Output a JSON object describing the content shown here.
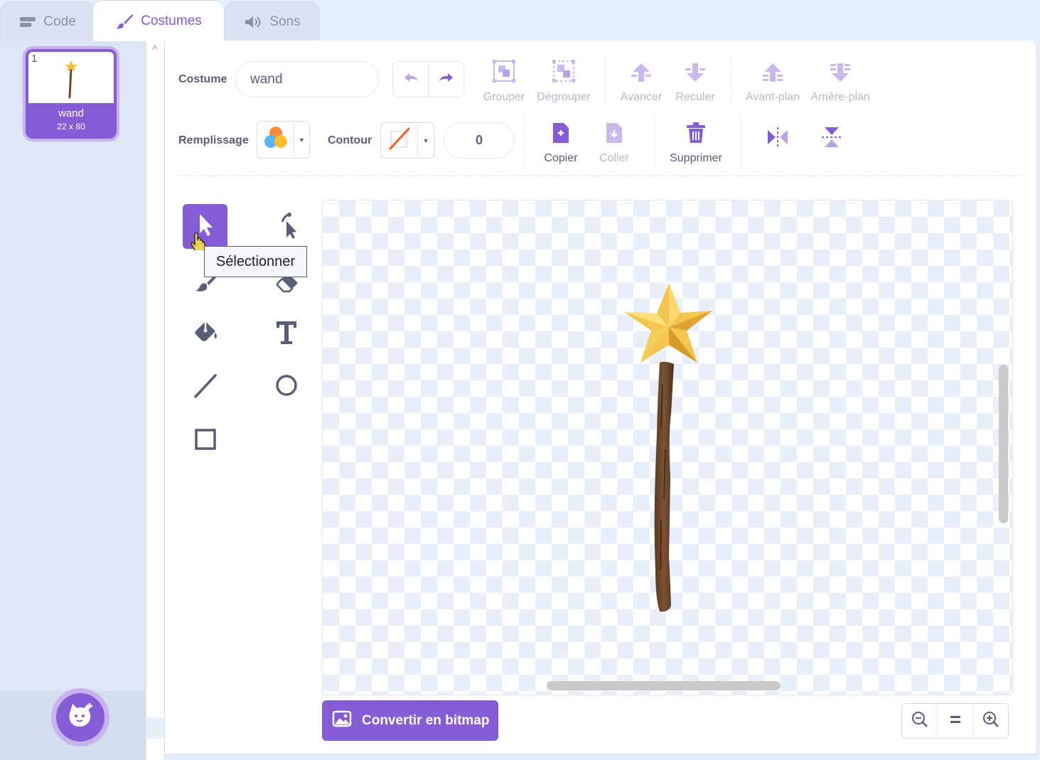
{
  "tabs": [
    {
      "label": "Code",
      "icon": "code-icon"
    },
    {
      "label": "Costumes",
      "icon": "paintbrush-icon"
    },
    {
      "label": "Sons",
      "icon": "speaker-icon"
    }
  ],
  "costume_list": {
    "items": [
      {
        "number": "1",
        "name": "wand",
        "size": "22 x 80"
      }
    ]
  },
  "toolbar": {
    "costume_label": "Costume",
    "costume_name": "wand",
    "group": "Grouper",
    "ungroup": "Dégrouper",
    "forward": "Avancer",
    "backward": "Reculer",
    "front": "Avant-plan",
    "back": "Arrière-plan",
    "fill_label": "Remplissage",
    "outline_label": "Contour",
    "outline_width": "0",
    "copy": "Copier",
    "paste": "Coller",
    "delete": "Supprimer"
  },
  "tools": {
    "tooltip": "Sélectionner"
  },
  "convert_button": "Convertir en bitmap",
  "colors": {
    "accent": "#855cd6",
    "accent_light": "#c8b3ee",
    "text": "#575e75",
    "disabled": "#b5bac6"
  }
}
